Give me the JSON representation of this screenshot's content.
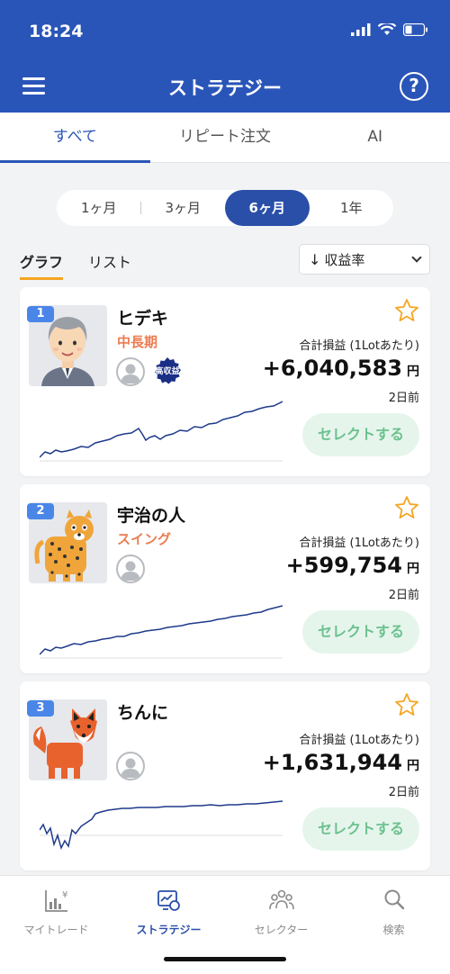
{
  "status_bar": {
    "time": "18:24"
  },
  "header": {
    "title": "ストラテジー",
    "help_label": "?"
  },
  "tabs": [
    {
      "label": "すべて",
      "active": true
    },
    {
      "label": "リピート注文",
      "active": false
    },
    {
      "label": "AI",
      "active": false
    }
  ],
  "period": {
    "options": [
      "1ヶ月",
      "3ヶ月",
      "6ヶ月",
      "1年"
    ],
    "selected": "6ヶ月"
  },
  "view_tabs": [
    {
      "label": "グラフ",
      "active": true
    },
    {
      "label": "リスト",
      "active": false
    }
  ],
  "sort": {
    "arrow": "↓",
    "label": "収益率"
  },
  "cards": [
    {
      "rank": "1",
      "name": "ヒデキ",
      "type": "中長期",
      "badge": "高収益",
      "profit_label": "合計損益 (1Lotあたり)",
      "profit": "+6,040,583",
      "yen": "円",
      "ago": "2日前",
      "button": "セレクトする"
    },
    {
      "rank": "2",
      "name": "宇治の人",
      "type": "スイング",
      "profit_label": "合計損益 (1Lotあたり)",
      "profit": "+599,754",
      "yen": "円",
      "ago": "2日前",
      "button": "セレクトする"
    },
    {
      "rank": "3",
      "name": "ちんに",
      "type": "",
      "profit_label": "合計損益 (1Lotあたり)",
      "profit": "+1,631,944",
      "yen": "円",
      "ago": "2日前",
      "button": "セレクトする"
    }
  ],
  "bottom_nav": [
    {
      "label": "マイトレード",
      "icon": "chart-yen-icon",
      "active": false
    },
    {
      "label": "ストラテジー",
      "icon": "strategy-icon",
      "active": true
    },
    {
      "label": "セレクター",
      "icon": "people-icon",
      "active": false
    },
    {
      "label": "検索",
      "icon": "search-icon",
      "active": false
    }
  ],
  "colors": {
    "header": "#2a55b8",
    "accent": "#2a4fa8",
    "profit_type": "#ec7d52",
    "select_btn": "#6cc18f",
    "star": "#f5a623"
  }
}
